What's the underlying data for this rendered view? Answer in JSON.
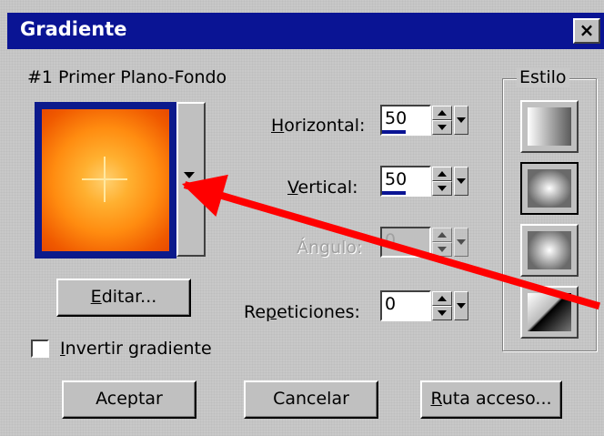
{
  "window": {
    "title": "Gradiente",
    "close_label": "×"
  },
  "preset_label": "#1 Primer Plano-Fondo",
  "fields": {
    "horizontal": {
      "label": "Horizontal:",
      "value": "50"
    },
    "vertical": {
      "label": "Vertical:",
      "value": "50"
    },
    "angulo": {
      "label": "Ángulo:",
      "value": "0"
    },
    "repeticiones": {
      "label": "Repeticiones:",
      "value": "0"
    }
  },
  "buttons": {
    "editar": "Editar...",
    "aceptar": "Aceptar",
    "cancelar": "Cancelar",
    "ruta": "Ruta acceso..."
  },
  "checkbox": {
    "label": "Invertir gradiente",
    "checked": false
  },
  "estilo": {
    "label": "Estilo",
    "options": [
      "linear-icon",
      "rectangular-icon",
      "radial-icon",
      "corner-icon"
    ],
    "selected_index": 1
  },
  "colors": {
    "title_bar": "#0a1494",
    "gradient_center": "#ffd070",
    "gradient_edge": "#e84a00",
    "arrow": "#ff0000"
  }
}
